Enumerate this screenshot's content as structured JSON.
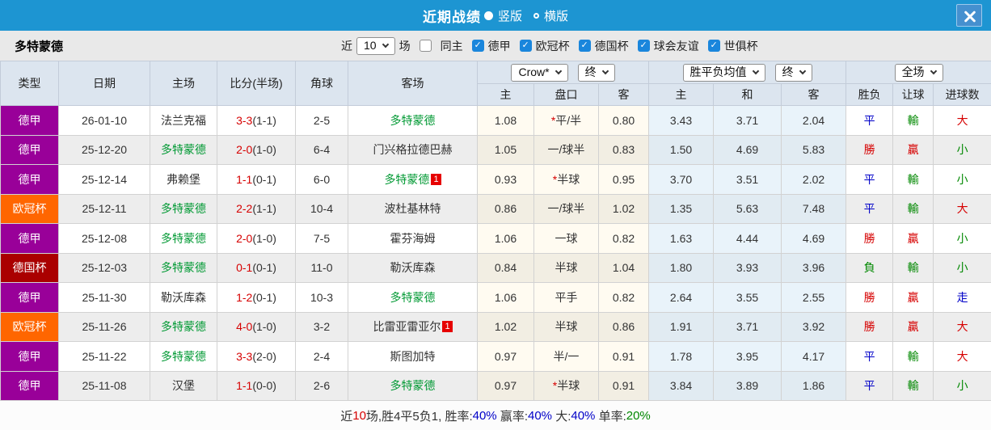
{
  "titlebar": {
    "title": "近期战绩",
    "vertical_option": "竖版",
    "horizontal_option": "横版"
  },
  "filterbar": {
    "team_name": "多特蒙德",
    "recent_label": "近",
    "recent_count": "10",
    "unit_label": "场",
    "filters": [
      {
        "label": "同主",
        "checked": false
      },
      {
        "label": "德甲",
        "checked": true
      },
      {
        "label": "欧冠杯",
        "checked": true
      },
      {
        "label": "德国杯",
        "checked": true
      },
      {
        "label": "球会友谊",
        "checked": true
      },
      {
        "label": "世俱杯",
        "checked": true
      }
    ]
  },
  "table": {
    "columns": [
      "类型",
      "日期",
      "主场",
      "比分(半场)",
      "角球",
      "客场"
    ],
    "controls": {
      "company_select": "Crow*",
      "company_period_select": "终",
      "avg_select": "胜平负均值",
      "avg_period_select": "终",
      "scope_select": "全场"
    },
    "sub_columns": [
      "主",
      "盘口",
      "客",
      "主",
      "和",
      "客",
      "胜负",
      "让球",
      "进球数"
    ],
    "rows": [
      {
        "league": "德甲",
        "league_color": "purple",
        "date": "26-01-10",
        "home": "法兰克福",
        "home_color": "dark",
        "score": "3-3",
        "half": "(1-1)",
        "corners": "2-5",
        "away": "多特蒙德",
        "away_color": "team",
        "away_mark": "",
        "crow_home": "1.08",
        "handicap_star": true,
        "handicap": "平/半",
        "crow_away": "0.80",
        "avg_home": "3.43",
        "avg_draw": "3.71",
        "avg_away": "2.04",
        "result": "平",
        "result_color": "blue",
        "cover": "輸",
        "cover_color": "green",
        "goals": "大",
        "goals_color": "red"
      },
      {
        "league": "德甲",
        "league_color": "purple",
        "date": "25-12-20",
        "home": "多特蒙德",
        "home_color": "team",
        "score": "2-0",
        "half": "(1-0)",
        "corners": "6-4",
        "away": "门兴格拉德巴赫",
        "away_color": "dark",
        "away_mark": "",
        "crow_home": "1.05",
        "handicap_star": false,
        "handicap": "一/球半",
        "crow_away": "0.83",
        "avg_home": "1.50",
        "avg_draw": "4.69",
        "avg_away": "5.83",
        "result": "勝",
        "result_color": "red",
        "cover": "贏",
        "cover_color": "red",
        "goals": "小",
        "goals_color": "green"
      },
      {
        "league": "德甲",
        "league_color": "purple",
        "date": "25-12-14",
        "home": "弗赖堡",
        "home_color": "dark",
        "score": "1-1",
        "half": "(0-1)",
        "corners": "6-0",
        "away": "多特蒙德",
        "away_color": "team",
        "away_mark": "1",
        "crow_home": "0.93",
        "handicap_star": true,
        "handicap": "半球",
        "crow_away": "0.95",
        "avg_home": "3.70",
        "avg_draw": "3.51",
        "avg_away": "2.02",
        "result": "平",
        "result_color": "blue",
        "cover": "輸",
        "cover_color": "green",
        "goals": "小",
        "goals_color": "green"
      },
      {
        "league": "欧冠杯",
        "league_color": "orange",
        "date": "25-12-11",
        "home": "多特蒙德",
        "home_color": "team",
        "score": "2-2",
        "half": "(1-1)",
        "corners": "10-4",
        "away": "波杜基林特",
        "away_color": "dark",
        "away_mark": "",
        "crow_home": "0.86",
        "handicap_star": false,
        "handicap": "一/球半",
        "crow_away": "1.02",
        "avg_home": "1.35",
        "avg_draw": "5.63",
        "avg_away": "7.48",
        "result": "平",
        "result_color": "blue",
        "cover": "輸",
        "cover_color": "green",
        "goals": "大",
        "goals_color": "red"
      },
      {
        "league": "德甲",
        "league_color": "purple",
        "date": "25-12-08",
        "home": "多特蒙德",
        "home_color": "team",
        "score": "2-0",
        "half": "(1-0)",
        "corners": "7-5",
        "away": "霍芬海姆",
        "away_color": "dark",
        "away_mark": "",
        "crow_home": "1.06",
        "handicap_star": false,
        "handicap": "一球",
        "crow_away": "0.82",
        "avg_home": "1.63",
        "avg_draw": "4.44",
        "avg_away": "4.69",
        "result": "勝",
        "result_color": "red",
        "cover": "贏",
        "cover_color": "red",
        "goals": "小",
        "goals_color": "green"
      },
      {
        "league": "德国杯",
        "league_color": "darkred",
        "date": "25-12-03",
        "home": "多特蒙德",
        "home_color": "team",
        "score": "0-1",
        "half": "(0-1)",
        "corners": "11-0",
        "away": "勒沃库森",
        "away_color": "dark",
        "away_mark": "",
        "crow_home": "0.84",
        "handicap_star": false,
        "handicap": "半球",
        "crow_away": "1.04",
        "avg_home": "1.80",
        "avg_draw": "3.93",
        "avg_away": "3.96",
        "result": "負",
        "result_color": "green",
        "cover": "輸",
        "cover_color": "green",
        "goals": "小",
        "goals_color": "green"
      },
      {
        "league": "德甲",
        "league_color": "purple",
        "date": "25-11-30",
        "home": "勒沃库森",
        "home_color": "dark",
        "score": "1-2",
        "half": "(0-1)",
        "corners": "10-3",
        "away": "多特蒙德",
        "away_color": "team",
        "away_mark": "",
        "crow_home": "1.06",
        "handicap_star": false,
        "handicap": "平手",
        "crow_away": "0.82",
        "avg_home": "2.64",
        "avg_draw": "3.55",
        "avg_away": "2.55",
        "result": "勝",
        "result_color": "red",
        "cover": "贏",
        "cover_color": "red",
        "goals": "走",
        "goals_color": "blue"
      },
      {
        "league": "欧冠杯",
        "league_color": "orange",
        "date": "25-11-26",
        "home": "多特蒙德",
        "home_color": "team",
        "score": "4-0",
        "half": "(1-0)",
        "corners": "3-2",
        "away": "比雷亚雷亚尔",
        "away_color": "dark",
        "away_mark": "1",
        "crow_home": "1.02",
        "handicap_star": false,
        "handicap": "半球",
        "crow_away": "0.86",
        "avg_home": "1.91",
        "avg_draw": "3.71",
        "avg_away": "3.92",
        "result": "勝",
        "result_color": "red",
        "cover": "贏",
        "cover_color": "red",
        "goals": "大",
        "goals_color": "red"
      },
      {
        "league": "德甲",
        "league_color": "purple",
        "date": "25-11-22",
        "home": "多特蒙德",
        "home_color": "team",
        "score": "3-3",
        "half": "(2-0)",
        "corners": "2-4",
        "away": "斯图加特",
        "away_color": "dark",
        "away_mark": "",
        "crow_home": "0.97",
        "handicap_star": false,
        "handicap": "半/一",
        "crow_away": "0.91",
        "avg_home": "1.78",
        "avg_draw": "3.95",
        "avg_away": "4.17",
        "result": "平",
        "result_color": "blue",
        "cover": "輸",
        "cover_color": "green",
        "goals": "大",
        "goals_color": "red"
      },
      {
        "league": "德甲",
        "league_color": "purple",
        "date": "25-11-08",
        "home": "汉堡",
        "home_color": "dark",
        "score": "1-1",
        "half": "(0-0)",
        "corners": "2-6",
        "away": "多特蒙德",
        "away_color": "team",
        "away_mark": "",
        "crow_home": "0.97",
        "handicap_star": true,
        "handicap": "半球",
        "crow_away": "0.91",
        "avg_home": "3.84",
        "avg_draw": "3.89",
        "avg_away": "1.86",
        "result": "平",
        "result_color": "blue",
        "cover": "輸",
        "cover_color": "green",
        "goals": "小",
        "goals_color": "green"
      }
    ]
  },
  "footer": {
    "segments": [
      {
        "text": "近",
        "color": "dark"
      },
      {
        "text": "10",
        "color": "red"
      },
      {
        "text": "场,胜4平5负1, 胜率:",
        "color": "dark"
      },
      {
        "text": "40%",
        "color": "blue"
      },
      {
        "text": " 赢率:",
        "color": "dark"
      },
      {
        "text": "40%",
        "color": "blue"
      },
      {
        "text": " 大:",
        "color": "dark"
      },
      {
        "text": "40%",
        "color": "blue"
      },
      {
        "text": " 单率:",
        "color": "dark"
      },
      {
        "text": "20%",
        "color": "green"
      }
    ]
  },
  "colors": {
    "titlebar_bg": "#1d95d2",
    "checkbox_blue": "#1a86dc",
    "league_purple": "#990099",
    "league_orange": "#ff6600",
    "league_darkred": "#aa0000",
    "team_green": "#009933",
    "score_red": "#e60000",
    "win_red": "#d60000",
    "draw_blue": "#0000c8",
    "lose_green": "#008800"
  }
}
